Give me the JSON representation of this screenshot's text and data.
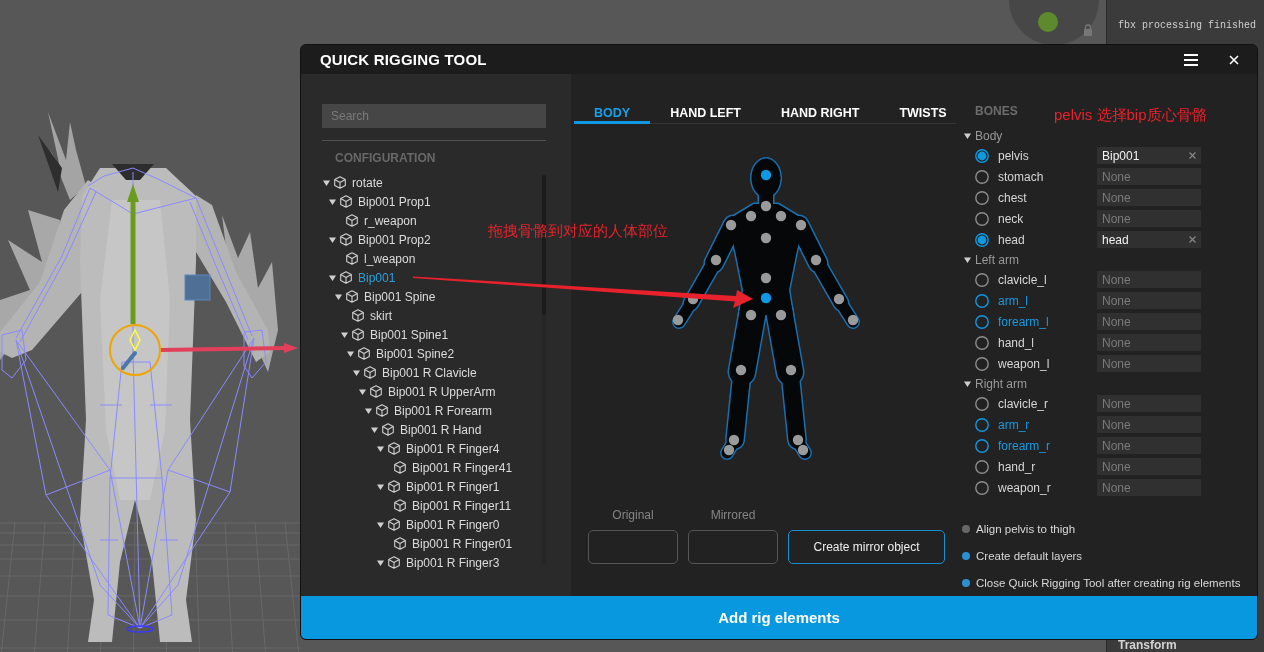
{
  "side_panel": {
    "log": [
      "fbx processing finished"
    ],
    "section": "Transform"
  },
  "dialog": {
    "title": "QUICK RIGGING TOOL"
  },
  "configuration": {
    "search": {
      "placeholder": "Search"
    },
    "heading": "CONFIGURATION",
    "tree": [
      {
        "label": "rotate",
        "selected": false,
        "expanded": true,
        "children": [
          {
            "label": "Bip001 Prop1",
            "selected": false,
            "expanded": true,
            "children": [
              {
                "label": "r_weapon",
                "selected": false
              }
            ]
          },
          {
            "label": "Bip001 Prop2",
            "selected": false,
            "expanded": true,
            "children": [
              {
                "label": "l_weapon",
                "selected": false
              }
            ]
          },
          {
            "label": "Bip001",
            "selected": true,
            "expanded": true,
            "children": [
              {
                "label": "Bip001 Spine",
                "selected": false,
                "expanded": true,
                "children": [
                  {
                    "label": "skirt",
                    "selected": false
                  },
                  {
                    "label": "Bip001 Spine1",
                    "selected": false,
                    "expanded": true,
                    "children": [
                      {
                        "label": "Bip001 Spine2",
                        "selected": false,
                        "expanded": true,
                        "children": [
                          {
                            "label": "Bip001 R Clavicle",
                            "selected": false,
                            "expanded": true,
                            "children": [
                              {
                                "label": "Bip001 R UpperArm",
                                "selected": false,
                                "expanded": true,
                                "children": [
                                  {
                                    "label": "Bip001 R Forearm",
                                    "selected": false,
                                    "expanded": true,
                                    "children": [
                                      {
                                        "label": "Bip001 R Hand",
                                        "selected": false,
                                        "expanded": true,
                                        "children": [
                                          {
                                            "label": "Bip001 R Finger4",
                                            "selected": false,
                                            "expanded": true,
                                            "children": [
                                              {
                                                "label": "Bip001 R Finger41",
                                                "selected": false
                                              }
                                            ]
                                          },
                                          {
                                            "label": "Bip001 R Finger1",
                                            "selected": false,
                                            "expanded": true,
                                            "children": [
                                              {
                                                "label": "Bip001 R Finger11",
                                                "selected": false
                                              }
                                            ]
                                          },
                                          {
                                            "label": "Bip001 R Finger0",
                                            "selected": false,
                                            "expanded": true,
                                            "children": [
                                              {
                                                "label": "Bip001 R Finger01",
                                                "selected": false
                                              }
                                            ]
                                          },
                                          {
                                            "label": "Bip001 R Finger3",
                                            "selected": false,
                                            "expanded": true
                                          }
                                        ]
                                      }
                                    ]
                                  }
                                ]
                              }
                            ]
                          }
                        ]
                      }
                    ]
                  }
                ]
              }
            ]
          }
        ]
      }
    ]
  },
  "tabs": [
    {
      "label": "BODY",
      "selected": true
    },
    {
      "label": "HAND LEFT",
      "selected": false
    },
    {
      "label": "HAND RIGHT",
      "selected": false
    },
    {
      "label": "TWISTS",
      "selected": false
    }
  ],
  "body_markers": [
    {
      "assigned": true
    },
    {
      "assigned": false
    },
    {
      "assigned": false
    },
    {
      "assigned": false
    },
    {
      "assigned": false
    },
    {
      "assigned": false
    },
    {
      "assigned": false
    },
    {
      "assigned": false
    },
    {
      "assigned": false
    },
    {
      "assigned": false
    },
    {
      "assigned": true
    },
    {
      "assigned": false
    },
    {
      "assigned": false
    },
    {
      "assigned": false
    },
    {
      "assigned": false
    },
    {
      "assigned": false
    },
    {
      "assigned": false
    },
    {
      "assigned": false
    },
    {
      "assigned": false
    },
    {
      "assigned": false
    },
    {
      "assigned": false
    },
    {
      "assigned": false
    },
    {
      "assigned": false
    }
  ],
  "mirror": {
    "original_label": "Original",
    "mirrored_label": "Mirrored",
    "button": "Create mirror object"
  },
  "bones": {
    "heading": "BONES",
    "groups": [
      {
        "name": "Body",
        "expanded": true,
        "bones": [
          {
            "name": "pelvis",
            "assigned": true,
            "highlighted": false,
            "value": "Bip001"
          },
          {
            "name": "stomach",
            "assigned": false,
            "highlighted": false,
            "placeholder": "None"
          },
          {
            "name": "chest",
            "assigned": false,
            "highlighted": false,
            "placeholder": "None"
          },
          {
            "name": "neck",
            "assigned": false,
            "highlighted": false,
            "placeholder": "None"
          },
          {
            "name": "head",
            "assigned": true,
            "highlighted": false,
            "value": "head"
          }
        ]
      },
      {
        "name": "Left arm",
        "expanded": true,
        "bones": [
          {
            "name": "clavicle_l",
            "assigned": false,
            "highlighted": false,
            "placeholder": "None"
          },
          {
            "name": "arm_l",
            "assigned": false,
            "highlighted": true,
            "placeholder": "None"
          },
          {
            "name": "forearm_l",
            "assigned": false,
            "highlighted": true,
            "placeholder": "None"
          },
          {
            "name": "hand_l",
            "assigned": false,
            "highlighted": false,
            "placeholder": "None"
          },
          {
            "name": "weapon_l",
            "assigned": false,
            "highlighted": false,
            "placeholder": "None"
          }
        ]
      },
      {
        "name": "Right arm",
        "expanded": true,
        "bones": [
          {
            "name": "clavicle_r",
            "assigned": false,
            "highlighted": false,
            "placeholder": "None"
          },
          {
            "name": "arm_r",
            "assigned": false,
            "highlighted": true,
            "placeholder": "None"
          },
          {
            "name": "forearm_r",
            "assigned": false,
            "highlighted": true,
            "placeholder": "None"
          },
          {
            "name": "hand_r",
            "assigned": false,
            "highlighted": false,
            "placeholder": "None"
          },
          {
            "name": "weapon_r",
            "assigned": false,
            "highlighted": false,
            "placeholder": "None"
          }
        ]
      }
    ]
  },
  "options": [
    {
      "label": "Align pelvis to thigh",
      "on": false
    },
    {
      "label": "Create default layers",
      "on": true
    },
    {
      "label": "Close Quick Rigging Tool after creating rig elements",
      "on": true
    }
  ],
  "add_button": {
    "label": "Add rig elements"
  },
  "annotations": [
    {
      "text": "拖拽骨骼到对应的人体部位"
    },
    {
      "text": "pelvis 选择bip质心骨骼"
    }
  ]
}
